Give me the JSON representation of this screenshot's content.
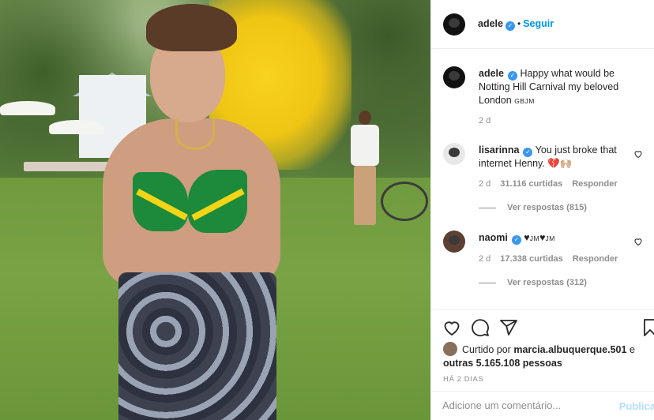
{
  "post": {
    "author": "adele",
    "follow_label": "Seguir",
    "dot": "•",
    "caption": "Happy what would be Notting Hill Carnival my beloved London",
    "caption_flag": "GBJM",
    "caption_time": "2 d"
  },
  "comments": [
    {
      "username": "lisarinna",
      "text": "You just broke that internet Henny. ",
      "emoji": "💔🙌🏼",
      "time": "2 d",
      "likes": "31.116 curtidas",
      "reply_label": "Responder",
      "view_replies": "Ver respostas (815)"
    },
    {
      "username": "naomi",
      "text": "♥",
      "flag1": "JM",
      "heart2": "♥",
      "flag2": "JM",
      "time": "2 d",
      "likes": "17.338 curtidas",
      "reply_label": "Responder",
      "view_replies": "Ver respostas (312)"
    }
  ],
  "likes": {
    "prefix": "Curtido por",
    "user": "marcia.albuquerque.501",
    "connector": "e",
    "others": "outras 5.165.108 pessoas"
  },
  "date_label": "HÁ 2 DIAS",
  "comment_box": {
    "placeholder": "Adicione um comentário...",
    "publish_label": "Publicar"
  },
  "colors": {
    "accent": "#0095f6",
    "verified": "#3897f0",
    "muted": "#8e8e8e"
  },
  "icons": [
    "verified-badge-icon",
    "heart-icon",
    "comment-icon",
    "share-icon",
    "save-icon"
  ]
}
